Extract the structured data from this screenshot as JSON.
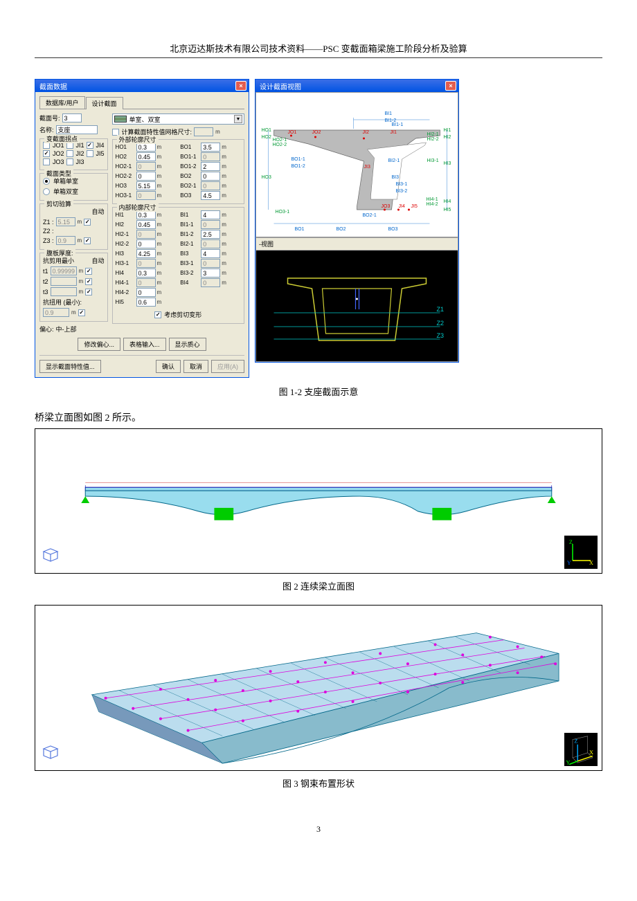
{
  "header": "北京迈达斯技术有限公司技术资料——PSC 变截面箱梁施工阶段分析及验算",
  "dialog": {
    "title": "截面数据",
    "tabs": {
      "a": "数据库/用户",
      "b": "设计截面"
    },
    "section_no_label": "截面号:",
    "section_no": "3",
    "name_label": "名称:",
    "name_value": "支座",
    "type_select": "单室、双室",
    "calc_grid_label": "计算截面特性值网格尺寸:",
    "calc_grid_unit": "m",
    "jpoints_title": "变截面拐点",
    "jpoints": {
      "JO1": false,
      "JI1": false,
      "JI4": true,
      "JO2": true,
      "JI2": false,
      "JI5": false,
      "JO3": false,
      "JI3": false
    },
    "sect_type_title": "截面类型",
    "sect_type": {
      "single": "单箱单室",
      "double": "单箱双室",
      "selected": "single"
    },
    "shear_title": "剪切验算",
    "auto_label": "自动",
    "z1_label": "Z1 :",
    "z1_val": "5.15",
    "z1_chk": true,
    "z2_label": "Z2 :",
    "z3_label": "Z3 :",
    "z3_val": "0.9",
    "z3_chk": true,
    "unit_m": "m",
    "flange_title": "腹板厚度:",
    "kangj_label": "抗剪用最小",
    "t1_label": "t1",
    "t1_val": "0.99999",
    "t1_chk": true,
    "t2_label": "t2",
    "t2_chk": true,
    "t3_label": "t3",
    "t3_chk": true,
    "kangn_label": "抗扭用 (最小):",
    "kangn_val": "0.9",
    "kangn_chk": true,
    "outer_title": "外部轮廓尺寸",
    "inner_title": "内部轮廓尺寸",
    "outer_dims": {
      "HO1": "0.3",
      "BO1": "3.5",
      "HO2": "0.45",
      "BO1-1": "0",
      "HO2-1": "0",
      "BO1-2": "2",
      "HO2-2": "0",
      "BO2": "0",
      "HO3": "5.15",
      "BO2-1": "0",
      "HO3-1": "0",
      "BO3": "4.5"
    },
    "inner_dims": {
      "HI1": "0.3",
      "BI1": "4",
      "HI2": "0.45",
      "BI1-1": "0",
      "HI2-1": "0",
      "BI1-2": "2.5",
      "HI2-2": "0",
      "BI2-1": "0",
      "HI3": "4.25",
      "BI3": "4",
      "HI3-1": "0",
      "BI3-1": "0",
      "HI4": "0.3",
      "BI3-2": "3",
      "HI4-1": "0",
      "BI4": "0",
      "HI4-2": "0",
      "HI5": "0.6"
    },
    "shear_deform_label": "考虑剪切变形",
    "shear_deform_chk": true,
    "offset_label": "偏心:",
    "offset_value": "中-上部",
    "btn_modify_offset": "修改偏心...",
    "btn_table_input": "表格输入...",
    "btn_show_center": "显示质心",
    "btn_show_props": "显示截面特性值...",
    "btn_ok": "确认",
    "btn_cancel": "取消",
    "btn_apply": "应用(A)"
  },
  "right_panel": {
    "title": "设计截面视图",
    "labels": [
      "BI1",
      "BI1-1",
      "BI1-2",
      "HI1",
      "HI2",
      "HI2-1",
      "HI2-2",
      "HI3",
      "HI3-1",
      "HI4",
      "HI4-1",
      "HI4-2",
      "HI5",
      "HO1",
      "HO2",
      "HO2-1",
      "HO2-2",
      "HO3",
      "HO3-1",
      "BO1",
      "BO1-1",
      "BO1-2",
      "BO2",
      "BO2-1",
      "BO3",
      "BI2-1",
      "BI3",
      "BI3-1",
      "BI3-2",
      "JO1",
      "JO2",
      "JO3",
      "JI1",
      "JI2",
      "JI3",
      "JI4",
      "JI5"
    ],
    "preview_title": "-视图",
    "z_labels": {
      "z1": "Z1",
      "z2": "Z2",
      "z3": "Z3"
    }
  },
  "caption_12": "图 1-2  支座截面示意",
  "body_1": "桥梁立面图如图 2 所示。",
  "caption_2": "图 2  连续梁立面图",
  "caption_3": "图 3  钢束布置形状",
  "page_num": "3",
  "axes": {
    "x": "X",
    "y": "Y",
    "z": "Z"
  }
}
